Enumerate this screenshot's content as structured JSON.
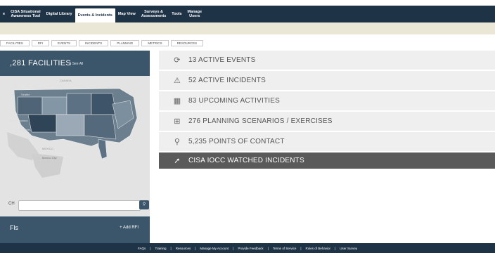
{
  "nav": {
    "items": [
      {
        "label": "e"
      },
      {
        "label": "CISA Situational\nAwareness Tool"
      },
      {
        "label": "Digital Library"
      },
      {
        "label": "Events & Incidents"
      },
      {
        "label": "Map View"
      },
      {
        "label": "Surveys &\nAssessments"
      },
      {
        "label": "Tools"
      },
      {
        "label": "Manage\nUsers"
      }
    ]
  },
  "tabs": [
    "FACILITIES",
    "RFI",
    "EVENTS",
    "INCIDENTS",
    "PLANNING",
    "METRICS",
    "RESOURCES"
  ],
  "facilities": {
    "title": ",281 FACILITIES",
    "see_all": "| See All",
    "map_labels": [
      "CANADA",
      "Seattle",
      "San Francisco",
      "Los Angeles",
      "MEXICO",
      "Mexico City"
    ]
  },
  "rfi": {
    "title": "Fls",
    "add_label": "+ Add RFI"
  },
  "search": {
    "label": "CH",
    "placeholder": "",
    "button_icon": "search-icon"
  },
  "stats": [
    {
      "icon": "refresh-icon",
      "label": "13 ACTIVE EVENTS"
    },
    {
      "icon": "warning-icon",
      "label": "52 ACTIVE INCIDENTS"
    },
    {
      "icon": "calendar-icon",
      "label": "83 UPCOMING ACTIVITIES"
    },
    {
      "icon": "flowchart-icon",
      "label": "276 PLANNING SCENARIOS / EXERCISES"
    },
    {
      "icon": "contact-icon",
      "label": "5,235 POINTS OF CONTACT"
    },
    {
      "icon": "trend-icon",
      "label": "CISA IOCC WATCHED INCIDENTS"
    }
  ],
  "footer": [
    "FAQs",
    "|",
    "Training",
    "|",
    "Resources",
    "|",
    "Manage My Account",
    "|",
    "Provide Feedback",
    "|",
    "Terms of Service",
    "|",
    "Rules of Behavior",
    "|",
    "User Survey"
  ]
}
